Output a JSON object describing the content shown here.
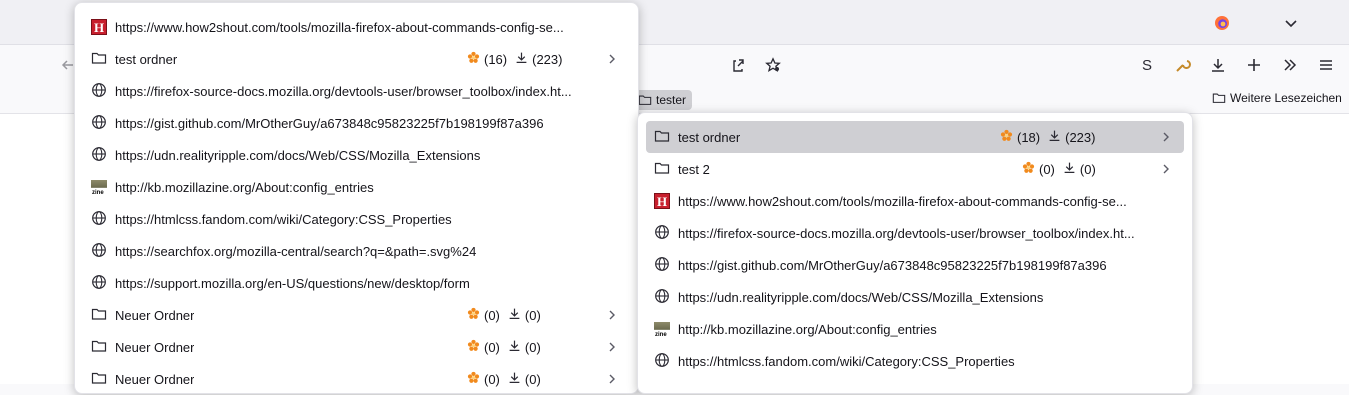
{
  "bookmarks_toolbar": {
    "tester_label": "tester",
    "other_bookmarks_label": "Weitere Lesezeichen"
  },
  "toolbar": {
    "s_label": "S"
  },
  "menu1": {
    "items": [
      {
        "type": "link",
        "label": "https://www.how2shout.com/tools/mozilla-firefox-about-commands-config-se...",
        "icon": "h2s-favicon"
      },
      {
        "type": "folder",
        "label": "test ordner",
        "stars": "(16)",
        "downloads": "(223)"
      },
      {
        "type": "link",
        "label": "https://firefox-source-docs.mozilla.org/devtools-user/browser_toolbox/index.ht...",
        "icon": "globe-icon"
      },
      {
        "type": "link",
        "label": "https://gist.github.com/MrOtherGuy/a673848c95823225f7b198199f87a396",
        "icon": "globe-icon"
      },
      {
        "type": "link",
        "label": "https://udn.realityripple.com/docs/Web/CSS/Mozilla_Extensions",
        "icon": "globe-icon"
      },
      {
        "type": "link",
        "label": "http://kb.mozillazine.org/About:config_entries",
        "icon": "zine-favicon"
      },
      {
        "type": "link",
        "label": "https://htmlcss.fandom.com/wiki/Category:CSS_Properties",
        "icon": "globe-icon"
      },
      {
        "type": "link",
        "label": "https://searchfox.org/mozilla-central/search?q=&path=.svg%24",
        "icon": "globe-icon"
      },
      {
        "type": "link",
        "label": "https://support.mozilla.org/en-US/questions/new/desktop/form",
        "icon": "globe-icon"
      },
      {
        "type": "folder",
        "label": "Neuer Ordner",
        "stars": "(0)",
        "downloads": "(0)"
      },
      {
        "type": "folder",
        "label": "Neuer Ordner",
        "stars": "(0)",
        "downloads": "(0)"
      },
      {
        "type": "folder",
        "label": "Neuer Ordner",
        "stars": "(0)",
        "downloads": "(0)"
      }
    ]
  },
  "menu2": {
    "items": [
      {
        "type": "folder",
        "label": "test ordner",
        "stars": "(18)",
        "downloads": "(223)",
        "highlighted": true
      },
      {
        "type": "folder",
        "label": "test 2",
        "stars": "(0)",
        "downloads": "(0)"
      },
      {
        "type": "link",
        "label": "https://www.how2shout.com/tools/mozilla-firefox-about-commands-config-se...",
        "icon": "h2s-favicon"
      },
      {
        "type": "link",
        "label": "https://firefox-source-docs.mozilla.org/devtools-user/browser_toolbox/index.ht...",
        "icon": "globe-icon"
      },
      {
        "type": "link",
        "label": "https://gist.github.com/MrOtherGuy/a673848c95823225f7b198199f87a396",
        "icon": "globe-icon"
      },
      {
        "type": "link",
        "label": "https://udn.realityripple.com/docs/Web/CSS/Mozilla_Extensions",
        "icon": "globe-icon"
      },
      {
        "type": "link",
        "label": "http://kb.mozillazine.org/About:config_entries",
        "icon": "zine-favicon"
      },
      {
        "type": "link",
        "label": "https://htmlcss.fandom.com/wiki/Category:CSS_Properties",
        "icon": "globe-icon"
      }
    ]
  },
  "colors": {
    "star": "#f18a1d",
    "highlight": "#cfcfd3"
  }
}
